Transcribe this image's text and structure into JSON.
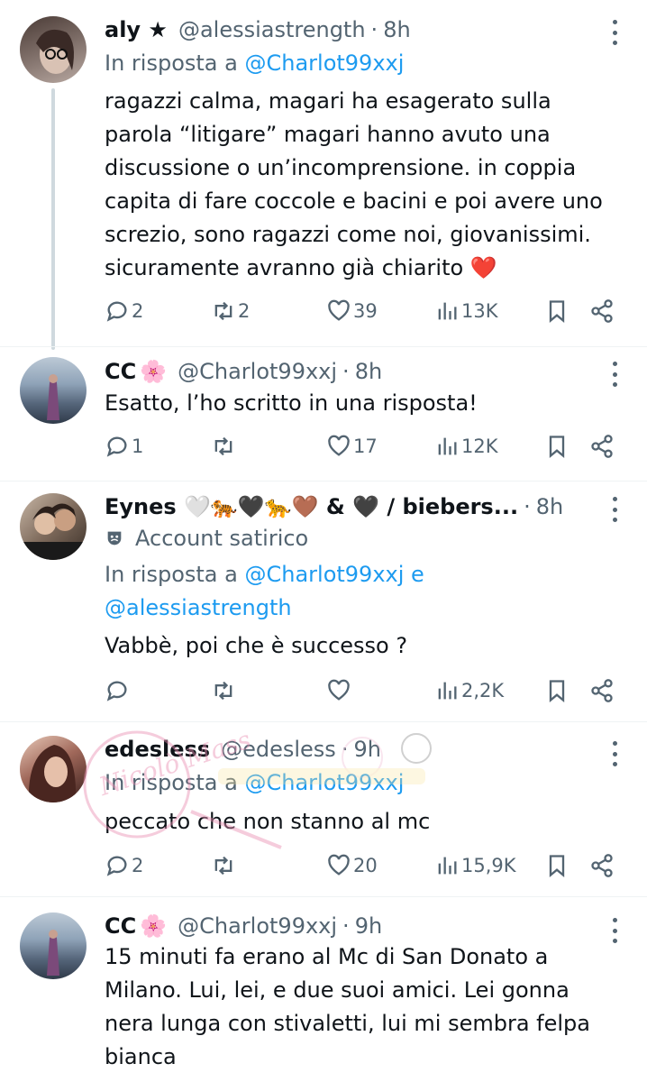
{
  "tweets": [
    {
      "display_name": "aly ★",
      "handle": "@alessiastrength",
      "time": "8h",
      "reply_prefix": "In risposta a",
      "reply_mentions": "@Charlot99xxj",
      "text": "ragazzi calma, magari ha esagerato sulla parola “litigare” magari hanno avuto una discussione o un’incomprensione. in coppia capita di fare coccole e bacini e poi avere uno screzio, sono ragazzi come noi, giovanissimi. sicuramente avranno già chiarito ❤️",
      "replies": "2",
      "reposts": "2",
      "likes": "39",
      "views": "13K"
    },
    {
      "display_name": "CC",
      "name_emoji": "🌸",
      "handle": "@Charlot99xxj",
      "time": "8h",
      "text": "Esatto, l’ho scritto in una risposta!",
      "replies": "1",
      "reposts": "",
      "likes": "17",
      "views": "12K"
    },
    {
      "display_name": "Eynes 🤍🐅🖤🐆🤎 & 🖤 / biebers...",
      "time": "8h",
      "label": "Account satirico",
      "reply_prefix": "In risposta a",
      "reply_mentions": "@Charlot99xxj e",
      "reply_mentions_2": "@alessiastrength",
      "text": "Vabbè, poi che è successo ?",
      "replies": "",
      "reposts": "",
      "likes": "",
      "views": "2,2K"
    },
    {
      "display_name": "edesless",
      "handle": "@edesless",
      "time": "9h",
      "reply_prefix": "In risposta a",
      "reply_mentions": "@Charlot99xxj",
      "text": "peccato che non stanno al mc",
      "replies": "2",
      "reposts": "",
      "likes": "20",
      "views": "15,9K"
    },
    {
      "display_name": "CC",
      "name_emoji": "🌸",
      "handle": "@Charlot99xxj",
      "time": "9h",
      "text": "15 minuti fa erano al Mc di San Donato a Milano. Lui, lei, e due suoi amici. Lei gonna nera lunga con stivaletti, lui mi sembra felpa bianca"
    }
  ],
  "watermark_text": "Nicolò Mass"
}
